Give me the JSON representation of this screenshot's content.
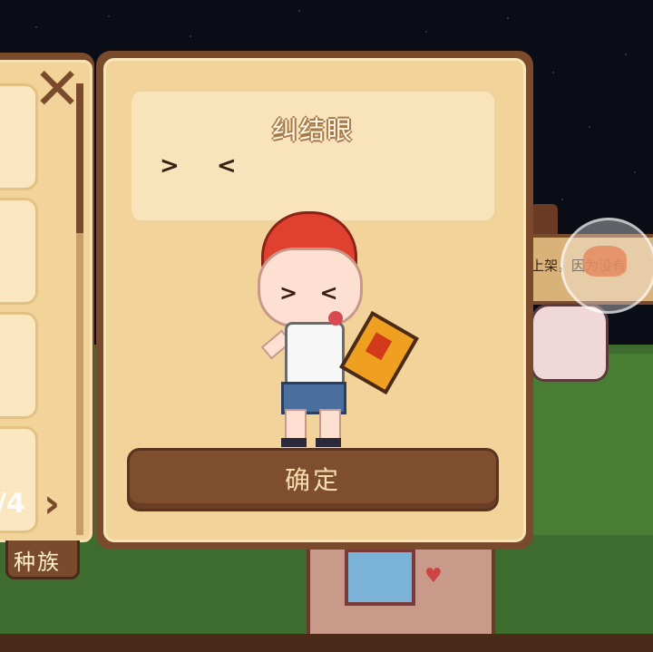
{
  "dialog": {
    "expression_name": "纠结眼",
    "expression_preview": "> <",
    "character_face": "> <",
    "confirm_label": "确定"
  },
  "side_panel": {
    "page_indicator": "/4",
    "race_tab_label": "种族",
    "icons": [
      "item-icon",
      "item-icon",
      "item-icon",
      "item-icon"
    ]
  },
  "background": {
    "sign_text": "上架，因为没有"
  },
  "colors": {
    "panel_border": "#7a4a2c",
    "panel_fill": "#f2d49a",
    "button_fill": "#7e4e2e",
    "button_text": "#f6dcae",
    "grass": "#3e6b2e"
  }
}
